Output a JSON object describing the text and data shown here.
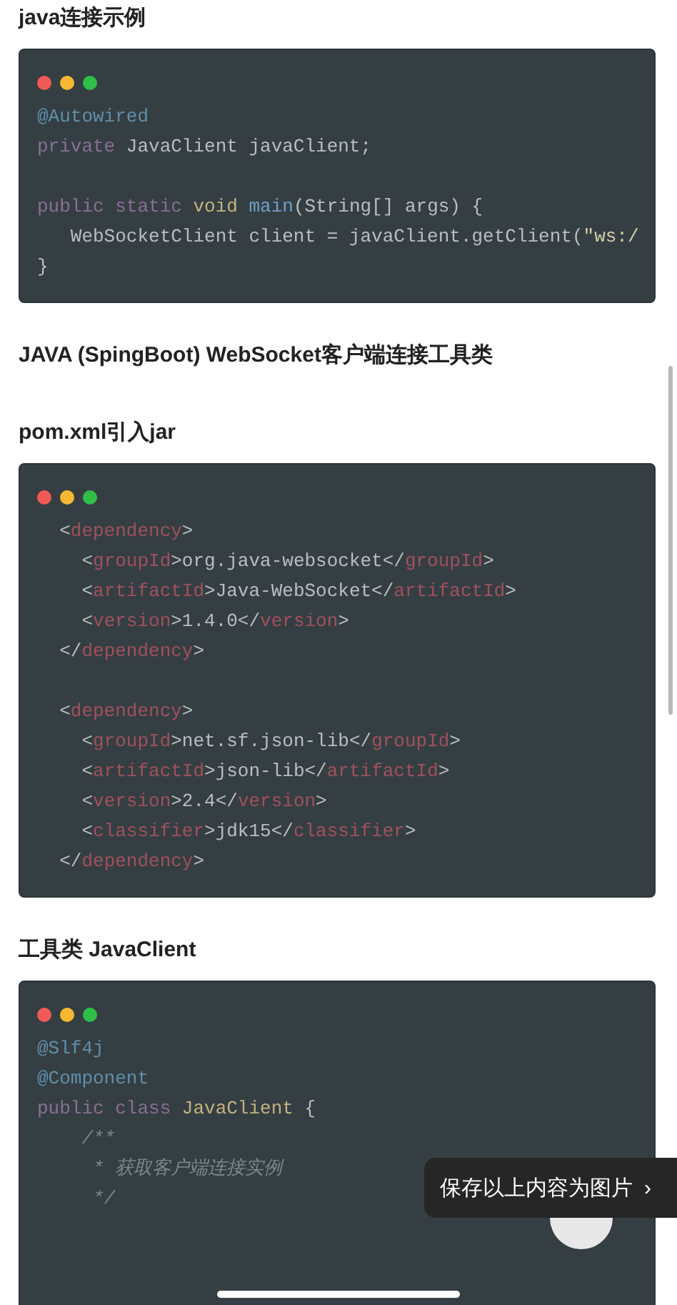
{
  "sections": [
    {
      "heading": "java连接示例",
      "code_groups": [
        [
          {
            "tokens": [
              {
                "text": "@Autowired",
                "kind": "annotation"
              }
            ]
          },
          {
            "tokens": [
              {
                "text": "private",
                "kind": "keyword"
              },
              {
                "text": " JavaClient javaClient;",
                "kind": "plain"
              }
            ]
          }
        ],
        [
          {
            "tokens": [
              {
                "text": "public static ",
                "kind": "keyword"
              },
              {
                "text": "void ",
                "kind": "type"
              },
              {
                "text": "main",
                "kind": "function"
              },
              {
                "text": "(String[] args) {",
                "kind": "plain"
              }
            ]
          },
          {
            "tokens": [
              {
                "text": "   WebSocketClient client = javaClient.getClient(",
                "kind": "plain"
              },
              {
                "text": "\"ws:/",
                "kind": "string"
              }
            ]
          },
          {
            "tokens": [
              {
                "text": "}",
                "kind": "plain"
              }
            ]
          }
        ]
      ]
    },
    {
      "heading": "JAVA (SpingBoot) WebSocket客户端连接工具类"
    },
    {
      "heading": "pom.xml引入jar",
      "code_groups": [
        [
          {
            "tokens": [
              {
                "text": "  <",
                "kind": "plain"
              },
              {
                "text": "dependency",
                "kind": "tag"
              },
              {
                "text": ">",
                "kind": "plain"
              }
            ]
          },
          {
            "tokens": [
              {
                "text": "    <",
                "kind": "plain"
              },
              {
                "text": "groupId",
                "kind": "tag"
              },
              {
                "text": ">org.java-websocket</",
                "kind": "plain"
              },
              {
                "text": "groupId",
                "kind": "tag"
              },
              {
                "text": ">",
                "kind": "plain"
              }
            ]
          },
          {
            "tokens": [
              {
                "text": "    <",
                "kind": "plain"
              },
              {
                "text": "artifactId",
                "kind": "tag"
              },
              {
                "text": ">Java-WebSocket</",
                "kind": "plain"
              },
              {
                "text": "artifactId",
                "kind": "tag"
              },
              {
                "text": ">",
                "kind": "plain"
              }
            ]
          },
          {
            "tokens": [
              {
                "text": "    <",
                "kind": "plain"
              },
              {
                "text": "version",
                "kind": "tag"
              },
              {
                "text": ">1.4.0</",
                "kind": "plain"
              },
              {
                "text": "version",
                "kind": "tag"
              },
              {
                "text": ">",
                "kind": "plain"
              }
            ]
          },
          {
            "tokens": [
              {
                "text": "  </",
                "kind": "plain"
              },
              {
                "text": "dependency",
                "kind": "tag"
              },
              {
                "text": ">",
                "kind": "plain"
              }
            ]
          }
        ],
        [
          {
            "tokens": [
              {
                "text": "  <",
                "kind": "plain"
              },
              {
                "text": "dependency",
                "kind": "tag"
              },
              {
                "text": ">",
                "kind": "plain"
              }
            ]
          },
          {
            "tokens": [
              {
                "text": "    <",
                "kind": "plain"
              },
              {
                "text": "groupId",
                "kind": "tag"
              },
              {
                "text": ">net.sf.json-lib</",
                "kind": "plain"
              },
              {
                "text": "groupId",
                "kind": "tag"
              },
              {
                "text": ">",
                "kind": "plain"
              }
            ]
          },
          {
            "tokens": [
              {
                "text": "    <",
                "kind": "plain"
              },
              {
                "text": "artifactId",
                "kind": "tag"
              },
              {
                "text": ">json-lib</",
                "kind": "plain"
              },
              {
                "text": "artifactId",
                "kind": "tag"
              },
              {
                "text": ">",
                "kind": "plain"
              }
            ]
          },
          {
            "tokens": [
              {
                "text": "    <",
                "kind": "plain"
              },
              {
                "text": "version",
                "kind": "tag"
              },
              {
                "text": ">2.4</",
                "kind": "plain"
              },
              {
                "text": "version",
                "kind": "tag"
              },
              {
                "text": ">",
                "kind": "plain"
              }
            ]
          },
          {
            "tokens": [
              {
                "text": "    <",
                "kind": "plain"
              },
              {
                "text": "classifier",
                "kind": "tag"
              },
              {
                "text": ">jdk15</",
                "kind": "plain"
              },
              {
                "text": "classifier",
                "kind": "tag"
              },
              {
                "text": ">",
                "kind": "plain"
              }
            ]
          },
          {
            "tokens": [
              {
                "text": "  </",
                "kind": "plain"
              },
              {
                "text": "dependency",
                "kind": "tag"
              },
              {
                "text": ">",
                "kind": "plain"
              }
            ]
          }
        ]
      ]
    },
    {
      "heading": "工具类 JavaClient",
      "code_groups": [
        [
          {
            "tokens": [
              {
                "text": "@Slf4j",
                "kind": "annotation"
              }
            ]
          },
          {
            "tokens": [
              {
                "text": "@Component",
                "kind": "annotation"
              }
            ]
          },
          {
            "tokens": [
              {
                "text": "public class ",
                "kind": "keyword"
              },
              {
                "text": "JavaClient",
                "kind": "type"
              },
              {
                "text": " {",
                "kind": "plain"
              }
            ]
          },
          {
            "tokens": [
              {
                "text": "    /**",
                "kind": "comment"
              }
            ]
          },
          {
            "tokens": [
              {
                "text": "     * 获取客户端连接实例",
                "kind": "comment"
              }
            ]
          },
          {
            "tokens": [
              {
                "text": "     */",
                "kind": "comment"
              }
            ]
          }
        ]
      ]
    }
  ],
  "save_prompt": {
    "label": "保存以上内容为图片",
    "arrow": "›"
  }
}
